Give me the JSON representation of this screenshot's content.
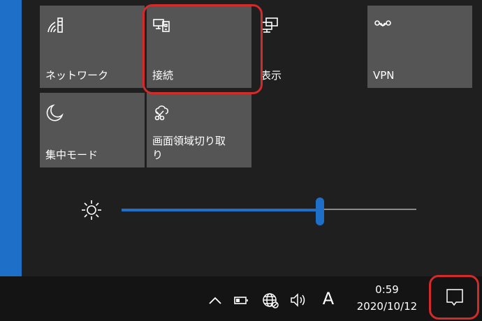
{
  "quick_actions": {
    "tiles": [
      {
        "label": "ネットワーク",
        "icon": "network-icon"
      },
      {
        "label": "接続",
        "icon": "connect-icon"
      },
      {
        "label": "表示",
        "icon": "display-icon"
      },
      {
        "label": "VPN",
        "icon": "vpn-icon"
      },
      {
        "label": "集中モード",
        "icon": "focus-assist-icon"
      },
      {
        "label": "画面領域切り取\nり",
        "icon": "snip-icon"
      }
    ]
  },
  "brightness": {
    "icon": "brightness-icon",
    "level_percent": 68
  },
  "taskbar": {
    "ime_label": "A",
    "time": "0:59",
    "date": "2020/10/12"
  },
  "colors": {
    "accent": "#1e6fc7",
    "tile_bg": "#555555",
    "panel_bg": "#1f1f1f",
    "highlight": "#d32a2a"
  }
}
